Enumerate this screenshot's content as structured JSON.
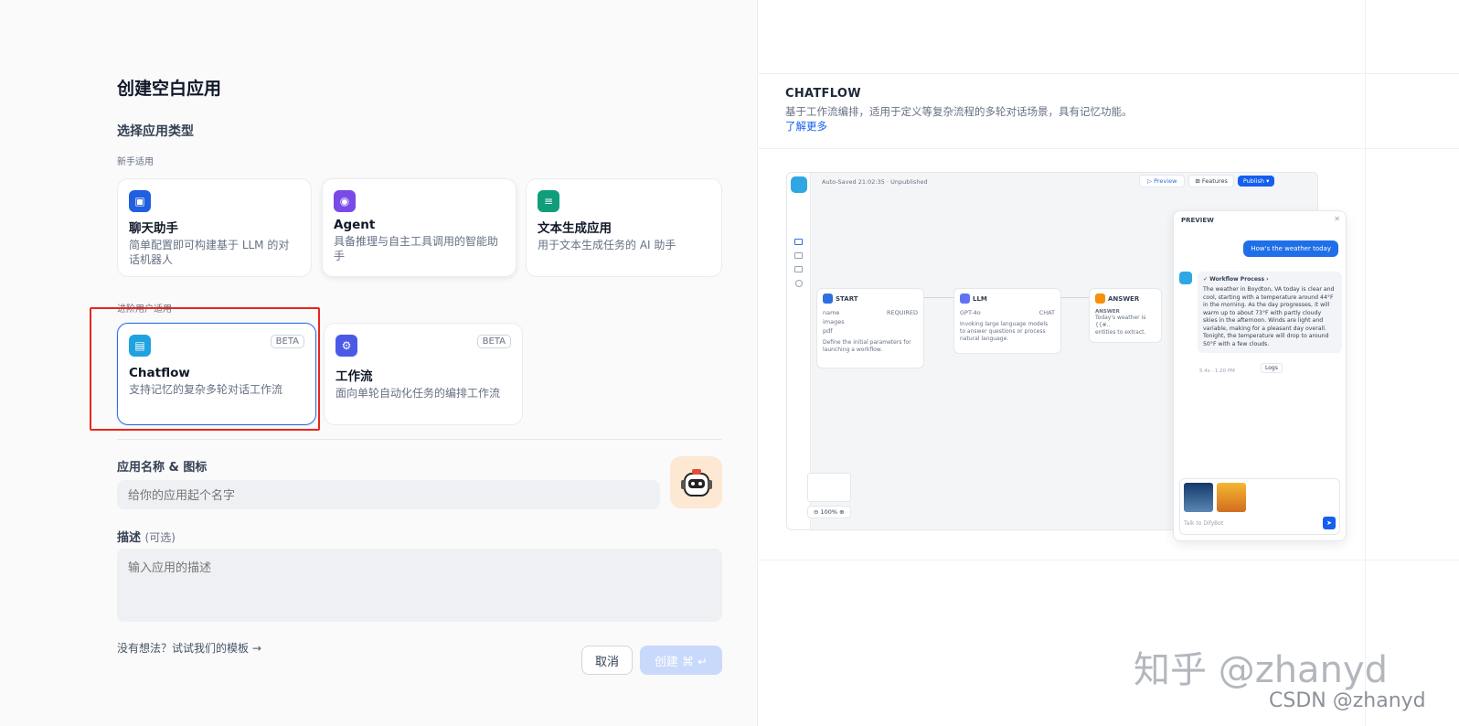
{
  "title": "创建空白应用",
  "section_type": "选择应用类型",
  "beginner_label": "新手适用",
  "advanced_label": "进阶用户适用",
  "beginner_cards": [
    {
      "title": "聊天助手",
      "desc": "简单配置即可构建基于 LLM 的对话机器人",
      "icon": "chat-bot-icon",
      "color": "#1f5fe0"
    },
    {
      "title": "Agent",
      "desc": "具备推理与自主工具调用的智能助手",
      "icon": "agent-icon",
      "color": "#7a4ae6"
    },
    {
      "title": "文本生成应用",
      "desc": "用于文本生成任务的 AI 助手",
      "icon": "text-generation-icon",
      "color": "#0f9d7a"
    }
  ],
  "advanced_cards": [
    {
      "title": "Chatflow",
      "desc": "支持记忆的复杂多轮对话工作流",
      "badge": "BETA",
      "icon": "chatflow-icon",
      "color": "#1fa2e0"
    },
    {
      "title": "工作流",
      "desc": "面向单轮自动化任务的编排工作流",
      "badge": "BETA",
      "icon": "workflow-icon",
      "color": "#4a5ae6"
    }
  ],
  "name_label": "应用名称 & 图标",
  "name_placeholder": "给你的应用起个名字",
  "desc_label": "描述",
  "desc_optional": "(可选)",
  "desc_placeholder": "输入应用的描述",
  "template_hint": "没有想法？试试我们的模板 →",
  "cancel": "取消",
  "create": "创建 ⌘ ↵",
  "preview": {
    "title": "CHATFLOW",
    "desc": "基于工作流编排，适用于定义等复杂流程的多轮对话场景，具有记忆功能。",
    "link": "了解更多",
    "autosave": "Auto-Saved 21:02:35 · Unpublished",
    "preview_btn": "Preview",
    "features_btn": "Features",
    "publish_btn": "Publish",
    "chat_header": "PREVIEW",
    "user_msg": "How's the weather today",
    "workflow_process": "Workflow Process",
    "bot_msg": "The weather in Boydton, VA today is clear and cool, starting with a temperature around 44°F in the morning. As the day progresses, it will warm up to about 73°F with partly cloudy skies in the afternoon. Winds are light and variable, making for a pleasant day overall. Tonight, the temperature will drop to around 50°F with a few clouds.",
    "bot_meta": "5.4s · 1.20 PM",
    "logs": "Logs",
    "chat_placeholder": "Talk to DifyBot",
    "zoom": "100%",
    "nodes": {
      "start": {
        "title": "START",
        "fields": [
          "name",
          "images",
          "pdf"
        ],
        "required": "REQUIRED",
        "desc": "Define the initial parameters for launching a workflow."
      },
      "llm": {
        "title": "LLM",
        "model": "GPT-4o",
        "mode": "CHAT",
        "desc": "Invoking large language models to answer questions or process natural language."
      },
      "answer": {
        "title": "ANSWER",
        "label": "ANSWER",
        "desc": "Today's weather is {{#..",
        "desc2": "entities to extract."
      }
    }
  },
  "watermarks": {
    "zhihu": "知乎 @zhanyd",
    "csdn": "CSDN @zhanyd"
  }
}
